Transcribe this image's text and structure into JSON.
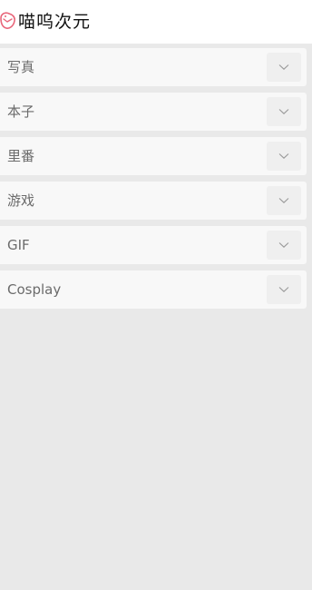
{
  "header": {
    "title": "喵呜次元",
    "logo_icon": "cat-bowl-icon"
  },
  "menu": {
    "items": [
      {
        "label": "写真",
        "toggle_icon": "chevron-down-icon"
      },
      {
        "label": "本子",
        "toggle_icon": "chevron-down-icon"
      },
      {
        "label": "里番",
        "toggle_icon": "chevron-down-icon"
      },
      {
        "label": "游戏",
        "toggle_icon": "chevron-down-icon"
      },
      {
        "label": "GIF",
        "toggle_icon": "chevron-down-icon"
      },
      {
        "label": "Cosplay",
        "toggle_icon": "chevron-down-icon"
      }
    ]
  },
  "colors": {
    "page_background": "#e9e9e9",
    "header_background": "#ffffff",
    "item_background": "#f8f8f8",
    "toggle_background": "#efefef",
    "logo_accent": "#e8667a",
    "label_text": "#6b6b6b"
  }
}
